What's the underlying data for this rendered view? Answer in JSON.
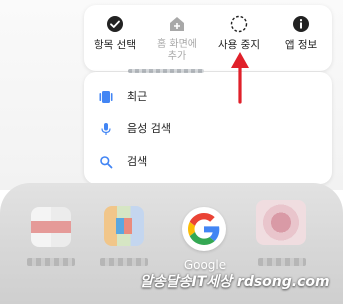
{
  "context_menu": {
    "actions": [
      {
        "label": "항목 선택",
        "icon": "check-circle-icon"
      },
      {
        "label": "홈 화면에\n추가",
        "icon": "add-home-icon"
      },
      {
        "label": "사용 중지",
        "icon": "dashed-circle-icon"
      },
      {
        "label": "앱 정보",
        "icon": "info-icon"
      }
    ],
    "shortcuts": [
      {
        "label": "최근",
        "icon": "recent-icon"
      },
      {
        "label": "음성 검색",
        "icon": "mic-icon"
      },
      {
        "label": "검색",
        "icon": "search-icon"
      }
    ]
  },
  "home": {
    "google_label": "Google"
  },
  "watermark": "알송달송IT세상 rdsong.com",
  "colors": {
    "accent_blue": "#4285F4",
    "arrow_red": "#e0202a"
  }
}
